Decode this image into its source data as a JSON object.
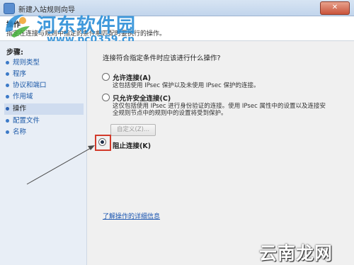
{
  "window": {
    "title": "新建入站规则向导",
    "close_glyph": "✕"
  },
  "header": {
    "title": "操作",
    "description": "指定在连接与规则中指定的条件相匹配时要执行的操作。"
  },
  "watermark": {
    "site_name": "河东软件园",
    "url": "www.pc0359.cn",
    "bottom_text": "云南龙网"
  },
  "sidebar": {
    "steps_label": "步骤:",
    "items": [
      {
        "label": "规则类型",
        "current": false
      },
      {
        "label": "程序",
        "current": false
      },
      {
        "label": "协议和端口",
        "current": false
      },
      {
        "label": "作用域",
        "current": false
      },
      {
        "label": "操作",
        "current": true
      },
      {
        "label": "配置文件",
        "current": false
      },
      {
        "label": "名称",
        "current": false
      }
    ]
  },
  "main": {
    "question": "连接符合指定条件时应该进行什么操作?",
    "options": [
      {
        "label": "允许连接(A)",
        "description": [
          "这包括使用 IPsec 保护以及未使用 IPsec 保护的连接。"
        ],
        "selected": false
      },
      {
        "label": "只允许安全连接(C)",
        "description": [
          "这仅包括使用 IPsec 进行身份验证的连接。使用 IPsec 属性中的设置以及连接安",
          "全规则节点中的规则中的设置将受到保护。"
        ],
        "selected": false
      },
      {
        "label": "阻止连接(K)",
        "description": [],
        "selected": true
      }
    ],
    "customize_button": "自定义(Z)...",
    "learn_more_link": "了解操作的详细信息"
  },
  "colors": {
    "accent": "#2c8fd8",
    "highlight": "#d23a2a",
    "link": "#1a55b0"
  }
}
